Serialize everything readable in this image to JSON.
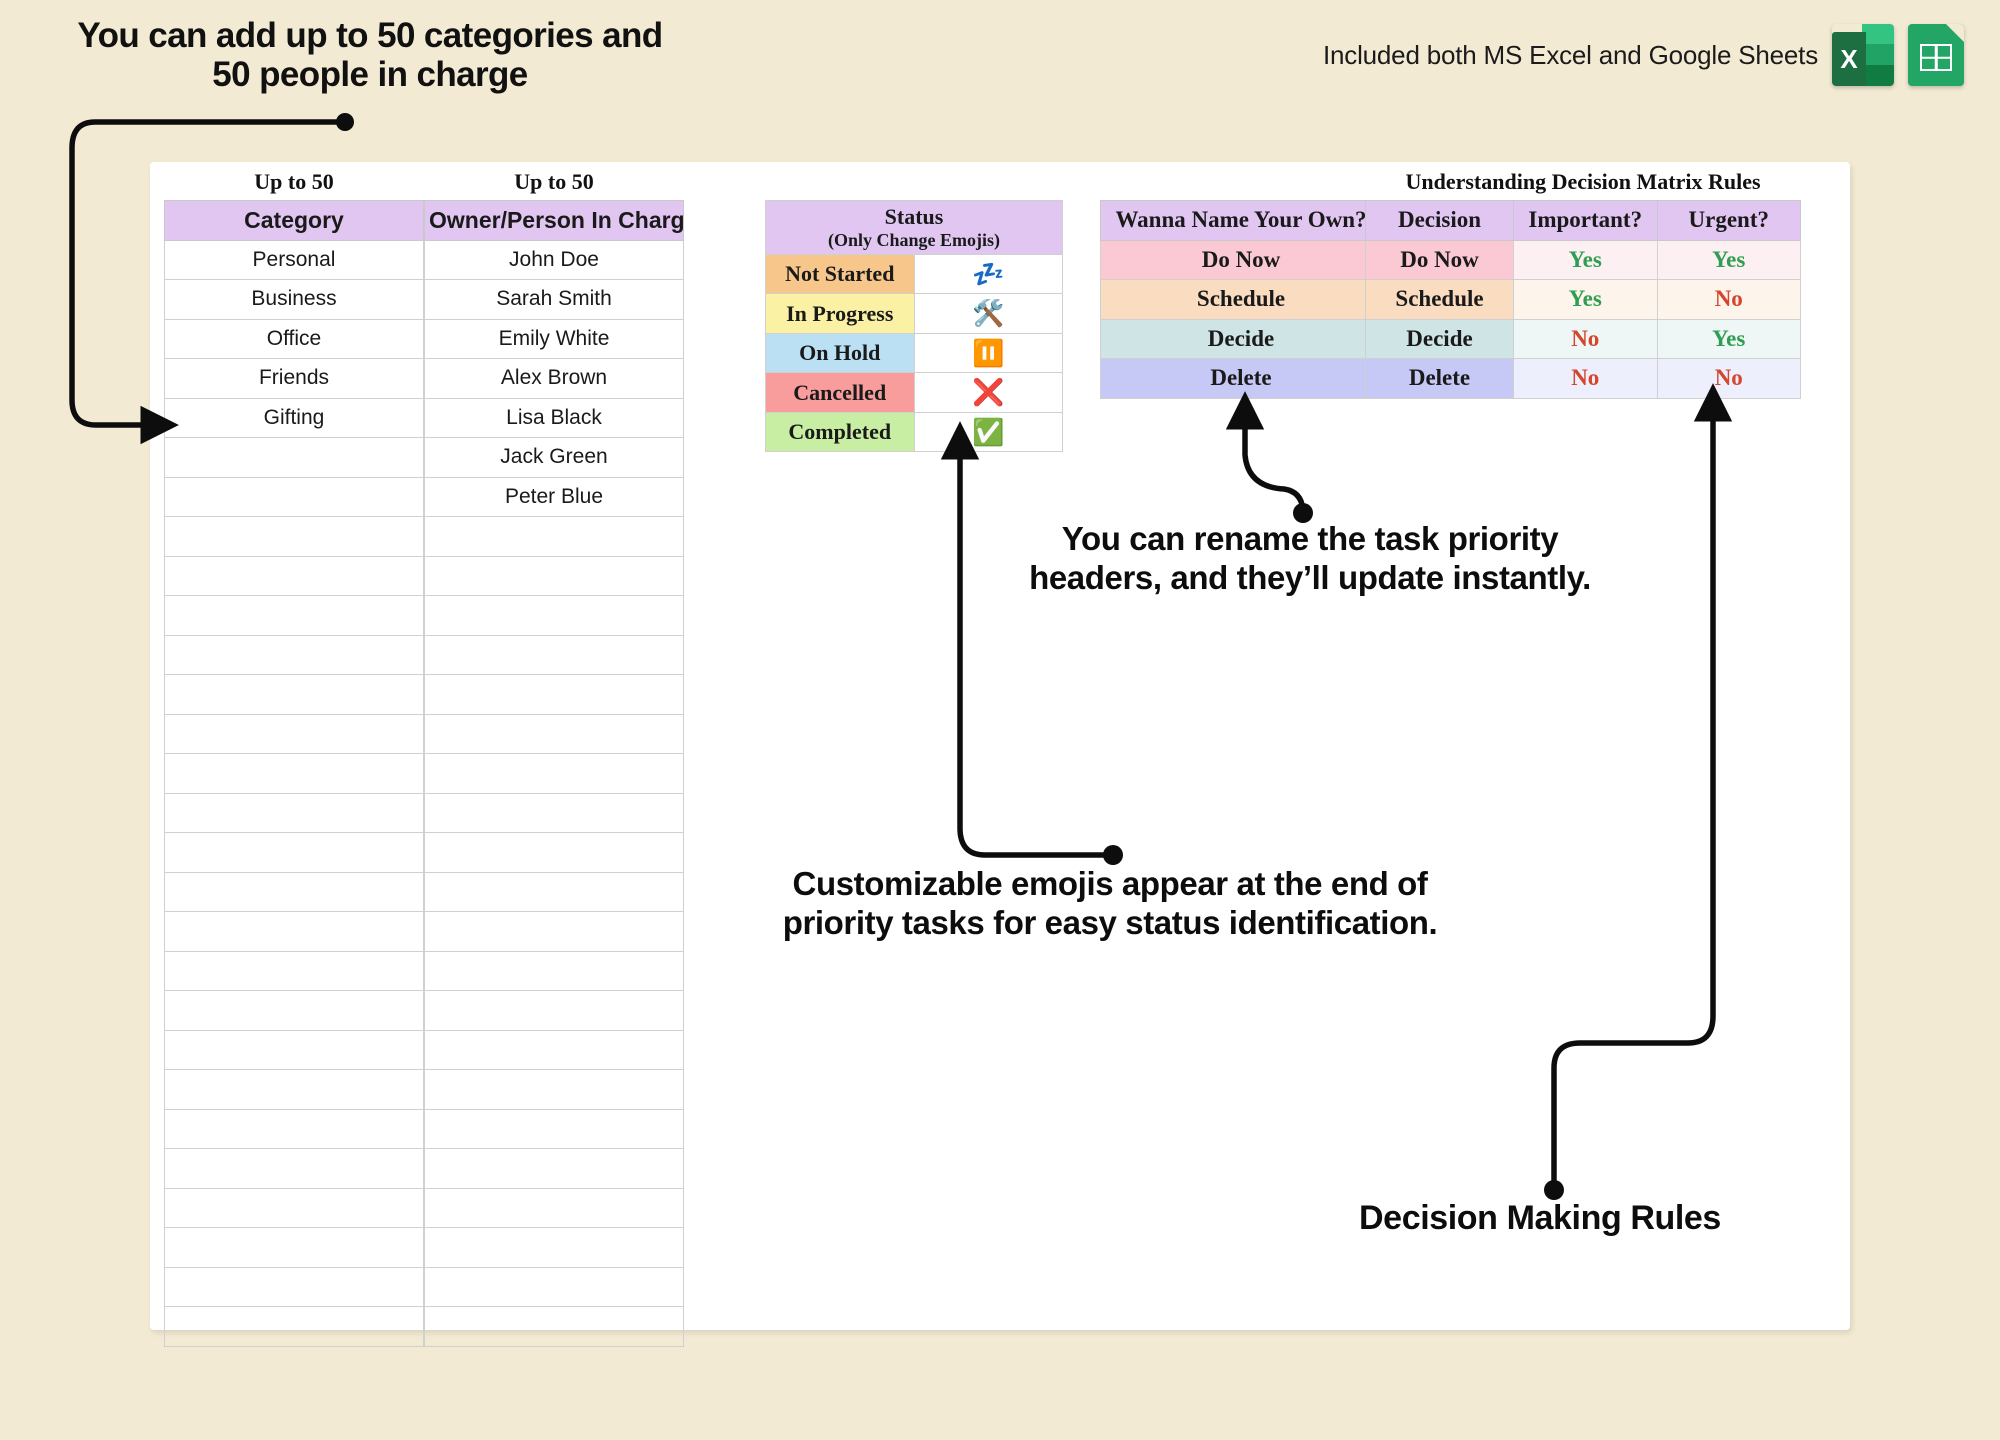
{
  "headline": {
    "line1": "You can add up to 50 categories and",
    "line2": "50 people in charge"
  },
  "included": {
    "text": "Included both MS Excel and Google Sheets",
    "excel_letter": "X",
    "excel_icon": "excel-icon",
    "sheets_icon": "google-sheets-icon"
  },
  "category_table": {
    "caption": "Up to 50",
    "header": "Category",
    "rows": [
      "Personal",
      "Business",
      "Office",
      "Friends",
      "Gifting"
    ],
    "empty_rows": 23
  },
  "owner_table": {
    "caption": "Up to 50",
    "header": "Owner/Person In Charge",
    "rows": [
      "John Doe",
      "Sarah Smith",
      "Emily White",
      "Alex Brown",
      "Lisa Black",
      "Jack Green",
      "Peter Blue"
    ],
    "empty_rows": 21
  },
  "status_table": {
    "header_title": "Status",
    "header_sub": "(Only Change Emojis)",
    "rows": [
      {
        "label": "Not Started",
        "emoji": "💤",
        "emoji_name": "zzz-emoji",
        "color": "#f6c68b"
      },
      {
        "label": "In Progress",
        "emoji": "🛠️",
        "emoji_name": "tools-emoji",
        "color": "#fbf1a4"
      },
      {
        "label": "On Hold",
        "emoji": "⏸️",
        "emoji_name": "pause-emoji",
        "color": "#bbdff3"
      },
      {
        "label": "Cancelled",
        "emoji": "❌",
        "emoji_name": "cross-mark-emoji",
        "color": "#f89c9c"
      },
      {
        "label": "Completed",
        "emoji": "✅",
        "emoji_name": "check-mark-emoji",
        "color": "#c8eea3"
      }
    ]
  },
  "rename_table": {
    "header": "Wanna Name Your Own?",
    "rows": [
      {
        "label": "Do Now",
        "color": "#fbc9d4"
      },
      {
        "label": "Schedule",
        "color": "#fadcc0"
      },
      {
        "label": "Decide",
        "color": "#cfe5e5"
      },
      {
        "label": "Delete",
        "color": "#c6c8f5"
      }
    ]
  },
  "matrix_table": {
    "caption": "Understanding Decision Matrix Rules",
    "headers": [
      "Decision",
      "Important?",
      "Urgent?"
    ],
    "rows": [
      {
        "decision": "Do Now",
        "important": "Yes",
        "urgent": "Yes",
        "label_color": "#fbc9d4",
        "cell_color": "#fdf0f2"
      },
      {
        "decision": "Schedule",
        "important": "Yes",
        "urgent": "No",
        "label_color": "#fadcc0",
        "cell_color": "#fdf4ec"
      },
      {
        "decision": "Decide",
        "important": "No",
        "urgent": "Yes",
        "label_color": "#cfe5e5",
        "cell_color": "#eff6f6"
      },
      {
        "decision": "Delete",
        "important": "No",
        "urgent": "No",
        "label_color": "#c6c8f5",
        "cell_color": "#eeeffc"
      }
    ]
  },
  "annotations": {
    "rename": "You can rename the task priority headers, and they’ll update instantly.",
    "emoji": "Customizable emojis appear at the end of priority tasks for easy status identification.",
    "rules": "Decision Making Rules"
  },
  "colors": {
    "background": "#f2ead3",
    "panel": "#ffffff",
    "header_purple": "#e2c6f2",
    "yes_green": "#2e9e52",
    "no_red": "#d4462e",
    "excel_green": "#1d6f42",
    "sheets_green": "#23a566"
  }
}
